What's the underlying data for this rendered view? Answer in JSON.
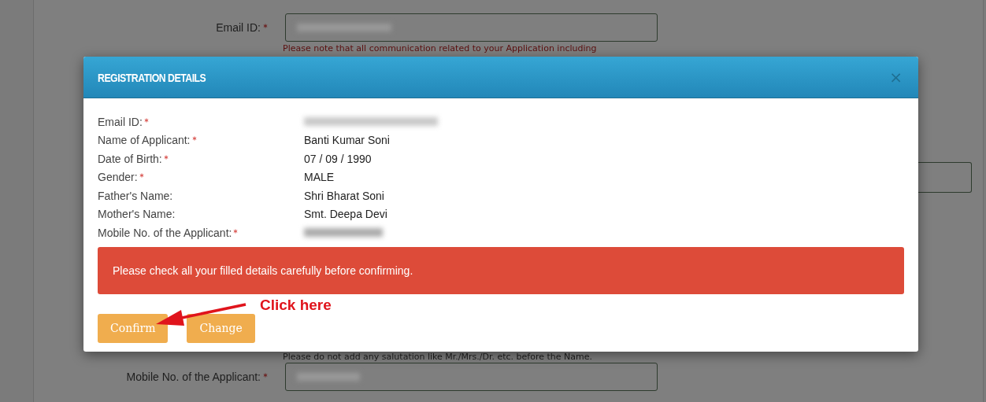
{
  "form": {
    "email": {
      "label": "Email ID:",
      "required": true,
      "blurred": true,
      "note": "Please note that all communication related to your Application including"
    },
    "salutation_note": "Please do not add any salutation like Mr./Mrs./Dr. etc. before the Name.",
    "mobile": {
      "label": "Mobile No. of the Applicant:",
      "required": true,
      "blurred": true
    }
  },
  "dialog": {
    "title": "REGISTRATION DETAILS",
    "close": "×",
    "rows": [
      {
        "label": "Email ID:",
        "required": true,
        "kind": "blurred"
      },
      {
        "label": "Name of Applicant:",
        "required": true,
        "kind": "text",
        "value": "Banti Kumar Soni"
      },
      {
        "label": "Date of Birth:",
        "required": true,
        "kind": "text",
        "value": "07 / 09 / 1990"
      },
      {
        "label": "Gender:",
        "required": true,
        "kind": "text",
        "value": "MALE"
      },
      {
        "label": "Father's Name:",
        "required": false,
        "kind": "text",
        "value": "Shri Bharat Soni"
      },
      {
        "label": "Mother's Name:",
        "required": false,
        "kind": "text",
        "value": "Smt. Deepa Devi"
      },
      {
        "label": "Mobile No. of the Applicant:",
        "required": true,
        "kind": "blurred"
      }
    ],
    "alert": "Please check all your filled details carefully before confirming.",
    "annotation": "Click here",
    "buttons": [
      "Confirm",
      "Change"
    ]
  }
}
